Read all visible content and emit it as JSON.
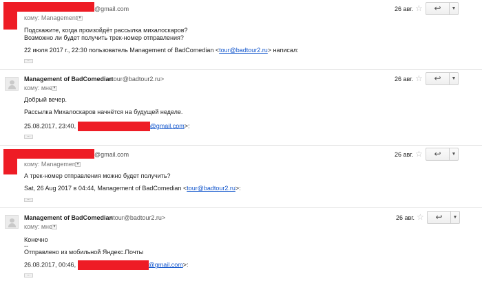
{
  "messages": [
    {
      "sender_name": "",
      "sender_email": "@gmail.com",
      "to_label": "кому: Management",
      "date": "26 авг.",
      "body": [
        "Подскажите, когда произойдёт рассылка михалоскаров?",
        "Возможно ли будет получить трек-номер отправления?"
      ],
      "quote_prefix": "22 июля 2017 г., 22:30 пользователь Management of BadComedian <",
      "quote_link": "tour@badtour2.ru",
      "quote_suffix": "> написал:"
    },
    {
      "sender_name": "Management of BadComedian",
      "sender_email": "<tour@badtour2.ru>",
      "to_label": "кому: мне",
      "date": "26 авг.",
      "body": [
        "Добрый вечер.",
        "Рассылка Михалоскаров начнётся на будущей неделе."
      ],
      "quote_prefix": "25.08.2017, 23:40, ",
      "quote_link": "@gmail.com",
      "quote_suffix": ">:"
    },
    {
      "sender_name": "",
      "sender_email": "@gmail.com",
      "to_label": "кому: Management",
      "date": "26 авг.",
      "body": [
        "А трек-номер отправления можно будет получить?"
      ],
      "quote_prefix": "Sat, 26 Aug 2017 в 04:44, Management of BadComedian <",
      "quote_link": "tour@badtour2.ru",
      "quote_suffix": ">:"
    },
    {
      "sender_name": "Management of BadComedian",
      "sender_email": "<tour@badtour2.ru>",
      "to_label": "кому: мне",
      "date": "26 авг.",
      "body": [
        "Конечно",
        "--",
        "Отправлено из мобильной Яндекс.Почты"
      ],
      "quote_prefix": "26.08.2017, 00:46, ",
      "quote_link": "@gmail.com",
      "quote_suffix": ">:"
    }
  ],
  "colors": {
    "redaction": "#ee1c25",
    "link": "#1155cc"
  },
  "icons": {
    "reply": "reply-arrow-icon",
    "more": "chevron-down-icon",
    "star": "star-outline-icon",
    "dropdown": "caret-down-icon",
    "ellipsis": "ellipsis-icon"
  }
}
